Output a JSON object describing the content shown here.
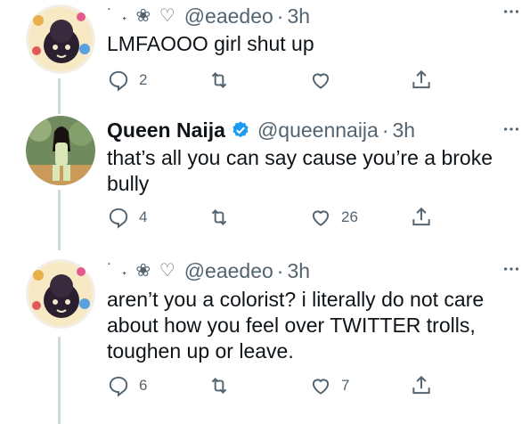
{
  "tweets": [
    {
      "name": "",
      "name_decoration": "˙ ˖ ❀ ♡",
      "handle": "@eaedeo",
      "time": "3h",
      "text": "LMFAOOO girl shut up",
      "replies": "2",
      "retweets": "",
      "likes": ""
    },
    {
      "name": "Queen Naija",
      "verified": true,
      "handle": "@queennaija",
      "time": "3h",
      "text": "that’s all you can say cause you’re a broke bully",
      "replies": "4",
      "retweets": "",
      "likes": "26"
    },
    {
      "name": "",
      "name_decoration": "˙ ˖ ❀ ♡",
      "handle": "@eaedeo",
      "time": "3h",
      "text": "aren’t you a colorist? i literally do not care about how you feel over TWITTER trolls, toughen up or leave.",
      "replies": "6",
      "retweets": "",
      "likes": "7"
    }
  ],
  "separator": "·",
  "icons": {
    "reply": "reply-icon",
    "retweet": "retweet-icon",
    "like": "like-icon",
    "share": "share-icon",
    "more": "more-icon",
    "verified": "verified-badge-icon"
  },
  "colors": {
    "text": "#0f1419",
    "secondary": "#536471",
    "verified": "#1d9bf0",
    "thread_line": "#cfd9de"
  }
}
